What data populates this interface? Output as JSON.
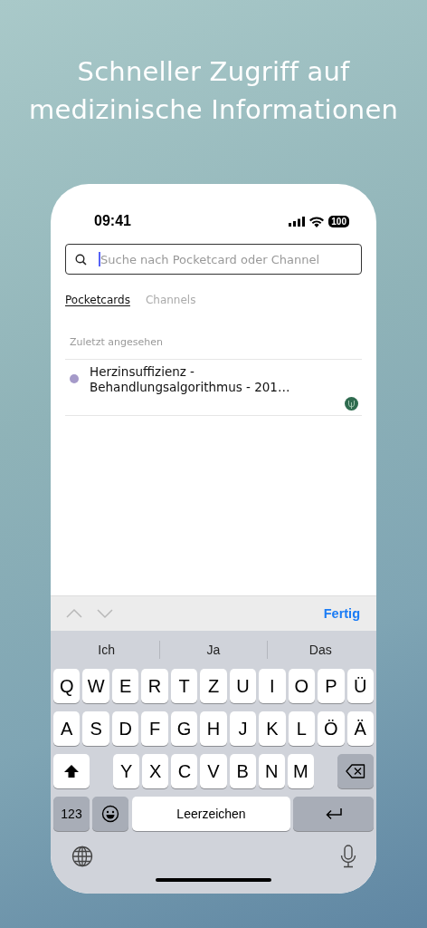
{
  "headline": [
    "Schneller Zugriff auf",
    "medizinische Informationen"
  ],
  "status_bar": {
    "time": "09:41",
    "battery": "100"
  },
  "search": {
    "placeholder": "Suche nach Pocketcard oder Channel",
    "focused": true
  },
  "tabs": [
    {
      "label": "Pocketcards",
      "selected": true
    },
    {
      "label": "Channels",
      "selected": false
    }
  ],
  "section_title": "Zuletzt angesehen",
  "recent": [
    {
      "title": "Herzinsuffizienz - Behandlungsalgorithmus - 201…",
      "color": "#a59ac9"
    }
  ],
  "keyboard_toolbar": {
    "previous_disabled": true,
    "next_disabled": true,
    "done": "Fertig"
  },
  "suggestions": [
    "Ich",
    "Ja",
    "Das"
  ],
  "key_rows": [
    [
      "Q",
      "W",
      "E",
      "R",
      "T",
      "Z",
      "U",
      "I",
      "O",
      "P",
      "Ü"
    ],
    [
      "A",
      "S",
      "D",
      "F",
      "G",
      "H",
      "J",
      "K",
      "L",
      "Ö",
      "Ä"
    ],
    [
      "Y",
      "X",
      "C",
      "V",
      "B",
      "N",
      "M"
    ]
  ],
  "mode_key": "123",
  "space_key": "Leerzeichen"
}
